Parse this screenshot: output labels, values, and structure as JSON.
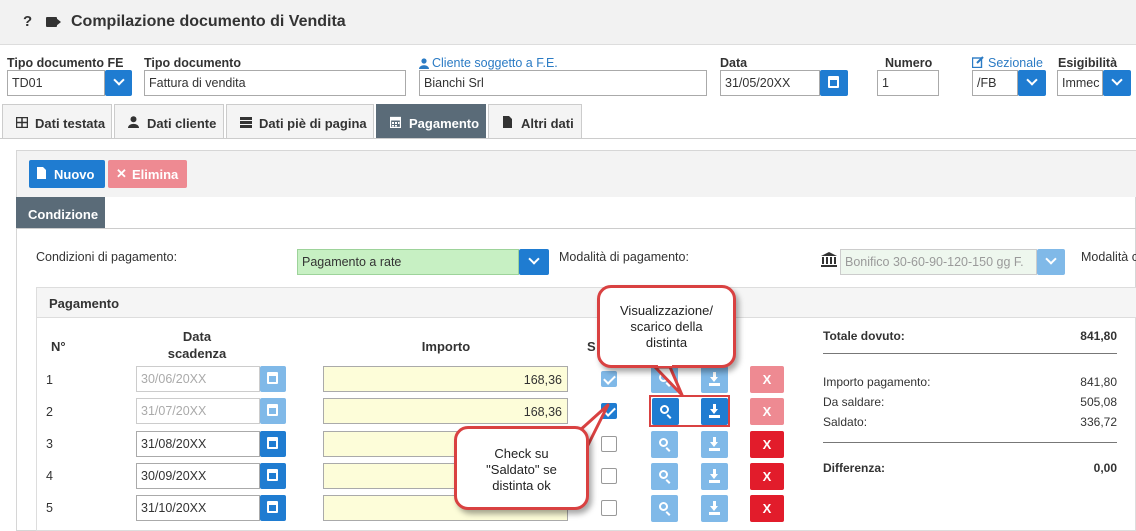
{
  "header": {
    "help": "?",
    "title": "Compilazione documento di Vendita"
  },
  "fields": {
    "tipo_doc_fe": {
      "label": "Tipo documento FE",
      "value": "TD01"
    },
    "tipo_doc": {
      "label": "Tipo documento",
      "value": "Fattura di vendita"
    },
    "cliente": {
      "label": "Cliente soggetto a F.E.",
      "value": "Bianchi Srl"
    },
    "data": {
      "label": "Data",
      "value": "31/05/20XX"
    },
    "numero": {
      "label": "Numero",
      "value": "1"
    },
    "sezionale": {
      "label": "Sezionale",
      "value": "/FB"
    },
    "esigibilita": {
      "label": "Esigibilità",
      "value": "Immec"
    }
  },
  "tabs": [
    {
      "label": "Dati testata",
      "icon": "table-icon",
      "active": false
    },
    {
      "label": "Dati cliente",
      "icon": "user-icon",
      "active": false
    },
    {
      "label": "Dati piè di pagina",
      "icon": "server-icon",
      "active": false
    },
    {
      "label": "Pagamento",
      "icon": "calendar-icon",
      "active": true
    },
    {
      "label": "Altri dati",
      "icon": "file-icon",
      "active": false
    }
  ],
  "toolbar": {
    "nuovo": "Nuovo",
    "elimina": "Elimina"
  },
  "condizione_tab": "Condizione",
  "condizioni": {
    "label": "Condizioni di pagamento:",
    "value": "Pagamento a rate",
    "modalita_label": "Modalità di pagamento:",
    "modalita_value": "Bonifico 30-60-90-120-150 gg F.",
    "modalita_label_2": "Modalità c"
  },
  "pagamento": {
    "title": "Pagamento",
    "col_n": "N°",
    "col_data_1": "Data",
    "col_data_2": "scadenza",
    "col_importo": "Importo",
    "col_s": "S",
    "rows": [
      {
        "n": "1",
        "data": "30/06/20XX",
        "importo": "168,36"
      },
      {
        "n": "2",
        "data": "31/07/20XX",
        "importo": "168,36"
      },
      {
        "n": "3",
        "data": "31/08/20XX",
        "importo": ""
      },
      {
        "n": "4",
        "data": "30/09/20XX",
        "importo": ""
      },
      {
        "n": "5",
        "data": "31/10/20XX",
        "importo": ""
      }
    ],
    "delete_label": "X"
  },
  "summary": {
    "totale_label": "Totale dovuto:",
    "totale_value": "841,80",
    "importo_label": "Importo pagamento:",
    "importo_value": "841,80",
    "da_saldare_label": "Da saldare:",
    "da_saldare_value": "505,08",
    "saldato_label": "Saldato:",
    "saldato_value": "336,72",
    "differenza_label": "Differenza:",
    "differenza_value": "0,00"
  },
  "callouts": {
    "distinta": [
      "Visualizzazione/",
      "scarico della",
      "distinta"
    ],
    "check": [
      "Check su",
      "\"Saldato\" se",
      "distinta ok"
    ]
  },
  "colors": {
    "primary": "#1f7cd1",
    "danger": "#e21c2b",
    "tab_active": "#5a6b78",
    "callout_border": "#d94141"
  }
}
